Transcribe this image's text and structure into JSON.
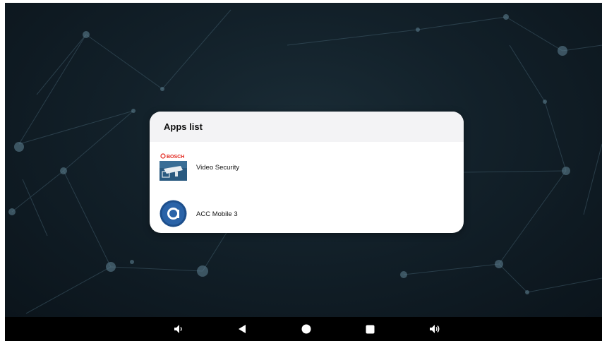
{
  "dialog": {
    "title": "Apps list",
    "apps": [
      {
        "label": "Video Security",
        "icon": "bosch-video-security-icon",
        "brand_text": "BOSCH"
      },
      {
        "label": "ACC Mobile 3",
        "icon": "acc-mobile-icon"
      }
    ]
  },
  "navbar": {
    "buttons": [
      "volume-down",
      "back",
      "home",
      "recents",
      "volume-up"
    ]
  },
  "colors": {
    "wallpaper": "#0f1a22",
    "dialog_header": "#f3f3f5",
    "bosch_red": "#e2231a",
    "acc_blue": "#1d4f8c"
  }
}
